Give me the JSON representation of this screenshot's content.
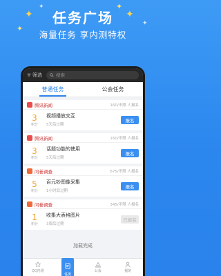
{
  "hero": {
    "title": "任务广场",
    "subtitle": "海量任务  享内测特权"
  },
  "topbar": {
    "filter_label": "筛选",
    "search_placeholder": "搜索"
  },
  "tabs": [
    {
      "label": "普通任务",
      "active": true
    },
    {
      "label": "公会任务",
      "active": false
    }
  ],
  "tasks": [
    {
      "source": "腾讯新闻",
      "source_icon": "tencent-icon",
      "count": "160/不限 人报名",
      "points": "3",
      "points_unit": "积分",
      "name": "视频播放交互",
      "expire": "5天后过期",
      "button": "报名",
      "status": "open"
    },
    {
      "source": "腾讯新闻",
      "source_icon": "tencent-icon",
      "count": "160/不限 人报名",
      "points": "3",
      "points_unit": "积分",
      "name": "话题功能的使用",
      "expire": "5天后过期",
      "button": "报名",
      "status": "open"
    },
    {
      "source": "问卷调查",
      "source_icon": "survey-icon",
      "count": "675/不限 人报名",
      "points": "5",
      "points_unit": "积分",
      "name": "百元钞图像采集",
      "expire": "1小时后过期",
      "button": "报名",
      "status": "open"
    },
    {
      "source": "问卷调查",
      "source_icon": "survey-icon",
      "count": "345/不限 人报名",
      "points": "1",
      "points_unit": "积分",
      "name": "收集大表格图片",
      "expire": "3周后过期",
      "button": "已报名",
      "status": "done"
    }
  ],
  "load_done": "加载完成",
  "bottom_nav": [
    {
      "label": "QQ内测",
      "icon": "star-icon",
      "active": false
    },
    {
      "label": "任务",
      "icon": "task-icon",
      "active": true
    },
    {
      "label": "公会",
      "icon": "guild-icon",
      "active": false
    },
    {
      "label": "我的",
      "icon": "user-icon",
      "active": false
    }
  ],
  "colors": {
    "background": "#2b86ee",
    "accent": "#3a8ff0",
    "points": "#f3a52e",
    "source": "#cc3333"
  }
}
